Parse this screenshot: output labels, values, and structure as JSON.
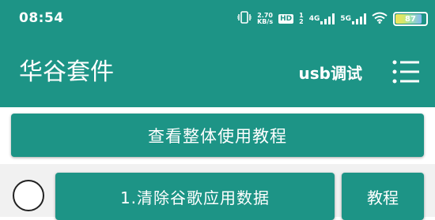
{
  "status_bar": {
    "time": "08:54",
    "net_speed_value": "2.70",
    "net_speed_unit": "KB/s",
    "hd_label": "HD",
    "sim_slot_top": "1",
    "sim_slot_bottom": "2",
    "signal1_label": "4G",
    "signal2_label": "5G",
    "battery_level": "87",
    "battery_fraction": 0.87,
    "icons": [
      "vibrate-icon",
      "hd-icon",
      "signal-4g-icon",
      "signal-5g-icon",
      "wifi-icon",
      "battery-icon"
    ]
  },
  "app_bar": {
    "title": "华谷套件",
    "usb_debug_label": "usb调试",
    "menu_icon": "menu-icon"
  },
  "main": {
    "tutorial_all_label": "查看整体使用教程",
    "rows": [
      {
        "checked": false,
        "action_label": "1.清除谷歌应用数据",
        "tutorial_label": "教程"
      }
    ]
  },
  "colors": {
    "primary": "#1d9486",
    "on_primary": "#ffffff",
    "row_background": "#f1f1f1"
  }
}
